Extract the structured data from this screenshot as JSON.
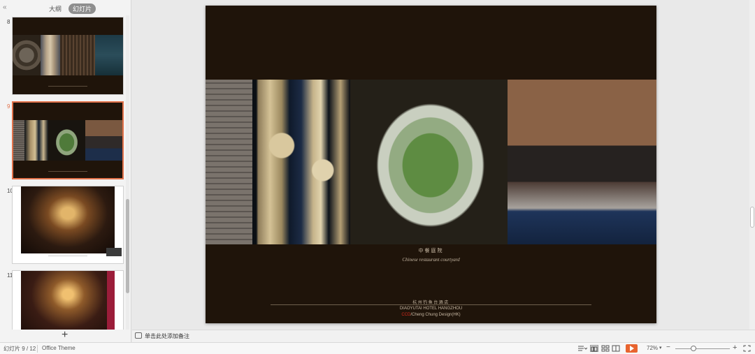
{
  "panel": {
    "collapse_icon": "«",
    "tabs": [
      {
        "label": "大纲"
      },
      {
        "label": "幻灯片",
        "active": true
      }
    ],
    "add_icon": "+",
    "thumbnails": [
      {
        "number": "8"
      },
      {
        "number": "9",
        "selected": true
      },
      {
        "number": "10"
      },
      {
        "number": "11"
      }
    ]
  },
  "slide": {
    "caption_cn": "中餐庭院",
    "caption_en": "Chinese restaurant courtyard",
    "hotel_cn": "杭州钓鱼台酒店",
    "hotel_en": "DIAOYUTAI HOTEL HANGZHOU",
    "credit_ccd": "CCD",
    "credit_rest": "/Cheng Chung Design(HK)"
  },
  "notes": {
    "placeholder": "单击此处添加备注"
  },
  "status": {
    "slide_counter": "幻灯片 9 / 12",
    "theme": "Office Theme",
    "zoom": "72%",
    "zoom_minus": "−",
    "zoom_plus": "+"
  },
  "colors": {
    "selection": "#e2724a",
    "slide_bg": "#1f140a",
    "play": "#e8642f",
    "credit_red": "#d42a1c"
  }
}
